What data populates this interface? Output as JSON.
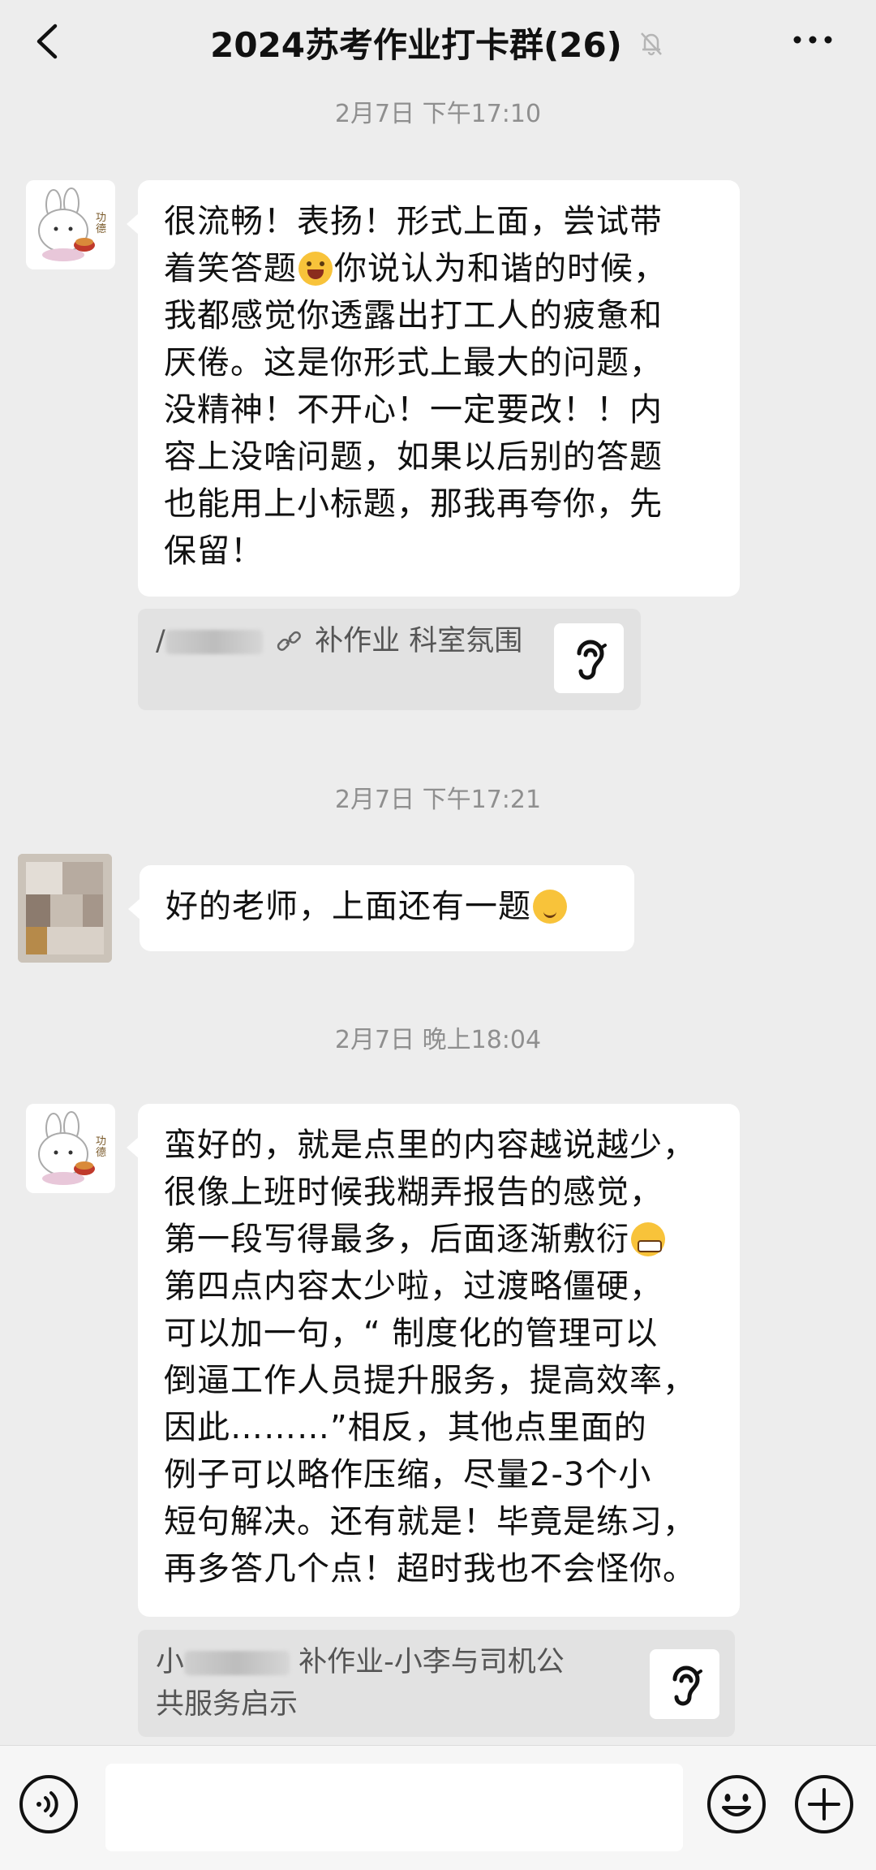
{
  "header": {
    "title": "2024苏考作业打卡群(26)",
    "back_icon": "back-chevron-icon",
    "mute_icon": "bell-muted-icon",
    "more_icon": "more-dots-icon"
  },
  "messages": [
    {
      "time": "2月7日 下午17:10",
      "sender": "teacher",
      "lines": [
        "很流畅！表扬！形式上面，尝试带",
        "着笑答题",
        "我都感觉你透露出打工人的疲惫和",
        "厌倦。这是你形式上最大的问题，",
        "没精神！不开心！一定要改！！内",
        "容上没啥问题，如果以后别的答题",
        "也能用上小标题，那我再夸你，先",
        "保留！"
      ],
      "line2_tail": "你说认为和谐的时候，",
      "quote": {
        "prefix": "/",
        "text": "补作业 科室氛围",
        "link_icon": "link-icon",
        "thumb_icon": "ear-icon"
      }
    },
    {
      "time": "2月7日 下午17:21",
      "sender": "student",
      "text": "好的老师，上面还有一题"
    },
    {
      "time": "2月7日 晚上18:04",
      "sender": "teacher",
      "lines": [
        "蛮好的，就是点里的内容越说越少，",
        "很像上班时候我糊弄报告的感觉，",
        "第一段写得最多，后面逐渐敷衍",
        "第四点内容太少啦，过渡略僵硬，",
        "可以加一句，“ 制度化的管理可以",
        "倒逼工作人员提升服务，提高效率，",
        "因此………”相反，其他点里面的",
        "例子可以略作压缩，尽量2-3个小",
        "短句解决。还有就是！毕竟是练习，",
        "再多答几个点！超时我也不会怪你。"
      ],
      "quote": {
        "prefix": "小",
        "line1": "补作业-小李与司机公",
        "line2": "共服务启示",
        "thumb_icon": "ear-icon"
      }
    }
  ],
  "input_bar": {
    "voice_icon": "voice-icon",
    "input_value": "",
    "emoji_icon": "emoji-icon",
    "plus_icon": "plus-icon"
  }
}
